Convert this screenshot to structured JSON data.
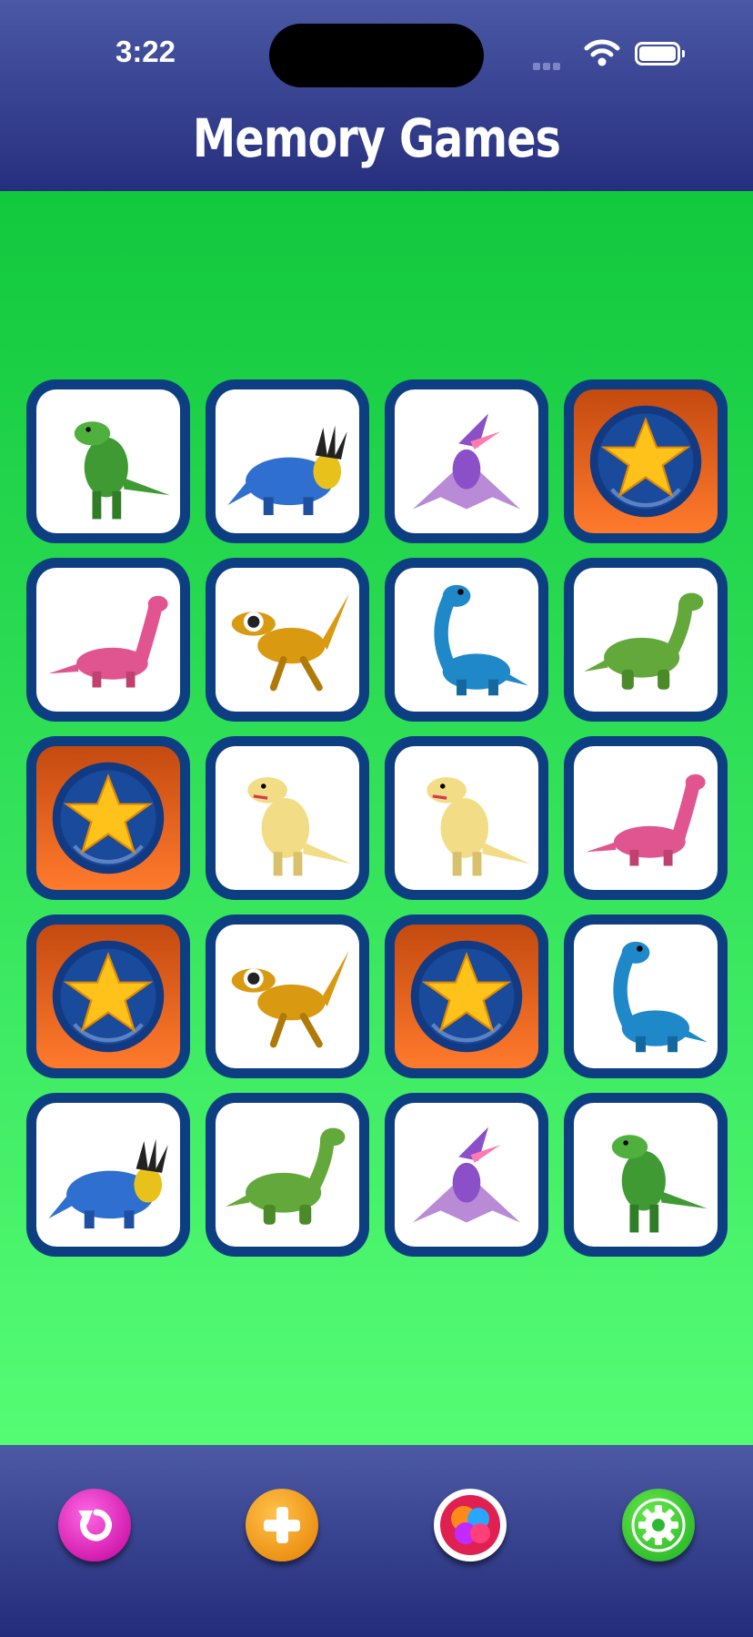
{
  "status": {
    "time": "3:22"
  },
  "header": {
    "title": "Memory Games"
  },
  "board": {
    "rows": [
      [
        {
          "state": "face-up",
          "icon": "green-trex-icon"
        },
        {
          "state": "face-up",
          "icon": "blue-styracosaurus-icon"
        },
        {
          "state": "face-up",
          "icon": "purple-pterodactyl-icon"
        },
        {
          "state": "face-down",
          "icon": "star-card-back-icon"
        }
      ],
      [
        {
          "state": "face-up",
          "icon": "pink-brontosaurus-icon"
        },
        {
          "state": "face-up",
          "icon": "yellow-raptor-icon"
        },
        {
          "state": "face-up",
          "icon": "blue-brachiosaurus-icon"
        },
        {
          "state": "face-up",
          "icon": "green-sauropod-icon"
        }
      ],
      [
        {
          "state": "face-down",
          "icon": "star-card-back-icon"
        },
        {
          "state": "face-up",
          "icon": "yellow-allosaurus-icon"
        },
        {
          "state": "face-up",
          "icon": "yellow-allosaurus-icon"
        },
        {
          "state": "face-up",
          "icon": "pink-brontosaurus-icon"
        }
      ],
      [
        {
          "state": "face-down",
          "icon": "star-card-back-icon"
        },
        {
          "state": "face-up",
          "icon": "yellow-raptor-icon"
        },
        {
          "state": "face-down",
          "icon": "star-card-back-icon"
        },
        {
          "state": "face-up",
          "icon": "blue-brachiosaurus-icon"
        }
      ],
      [
        {
          "state": "face-up",
          "icon": "blue-styracosaurus-icon"
        },
        {
          "state": "face-up",
          "icon": "green-sauropod-icon"
        },
        {
          "state": "face-up",
          "icon": "purple-pterodactyl-icon"
        },
        {
          "state": "face-up",
          "icon": "green-trex-icon"
        }
      ]
    ]
  },
  "toolbar": {
    "buttons": [
      {
        "name": "reset-button",
        "icon": "refresh-icon"
      },
      {
        "name": "add-button",
        "icon": "plus-icon"
      },
      {
        "name": "colors-button",
        "icon": "color-balls-icon"
      },
      {
        "name": "settings-button",
        "icon": "gear-icon"
      }
    ]
  },
  "colors": {
    "header_bg": "#2f3a8a",
    "board_top": "#12c83d",
    "board_bottom": "#54fc74",
    "card_border": "#0d3e82",
    "card_back": "#e0651e",
    "star": "#ffc21a"
  }
}
